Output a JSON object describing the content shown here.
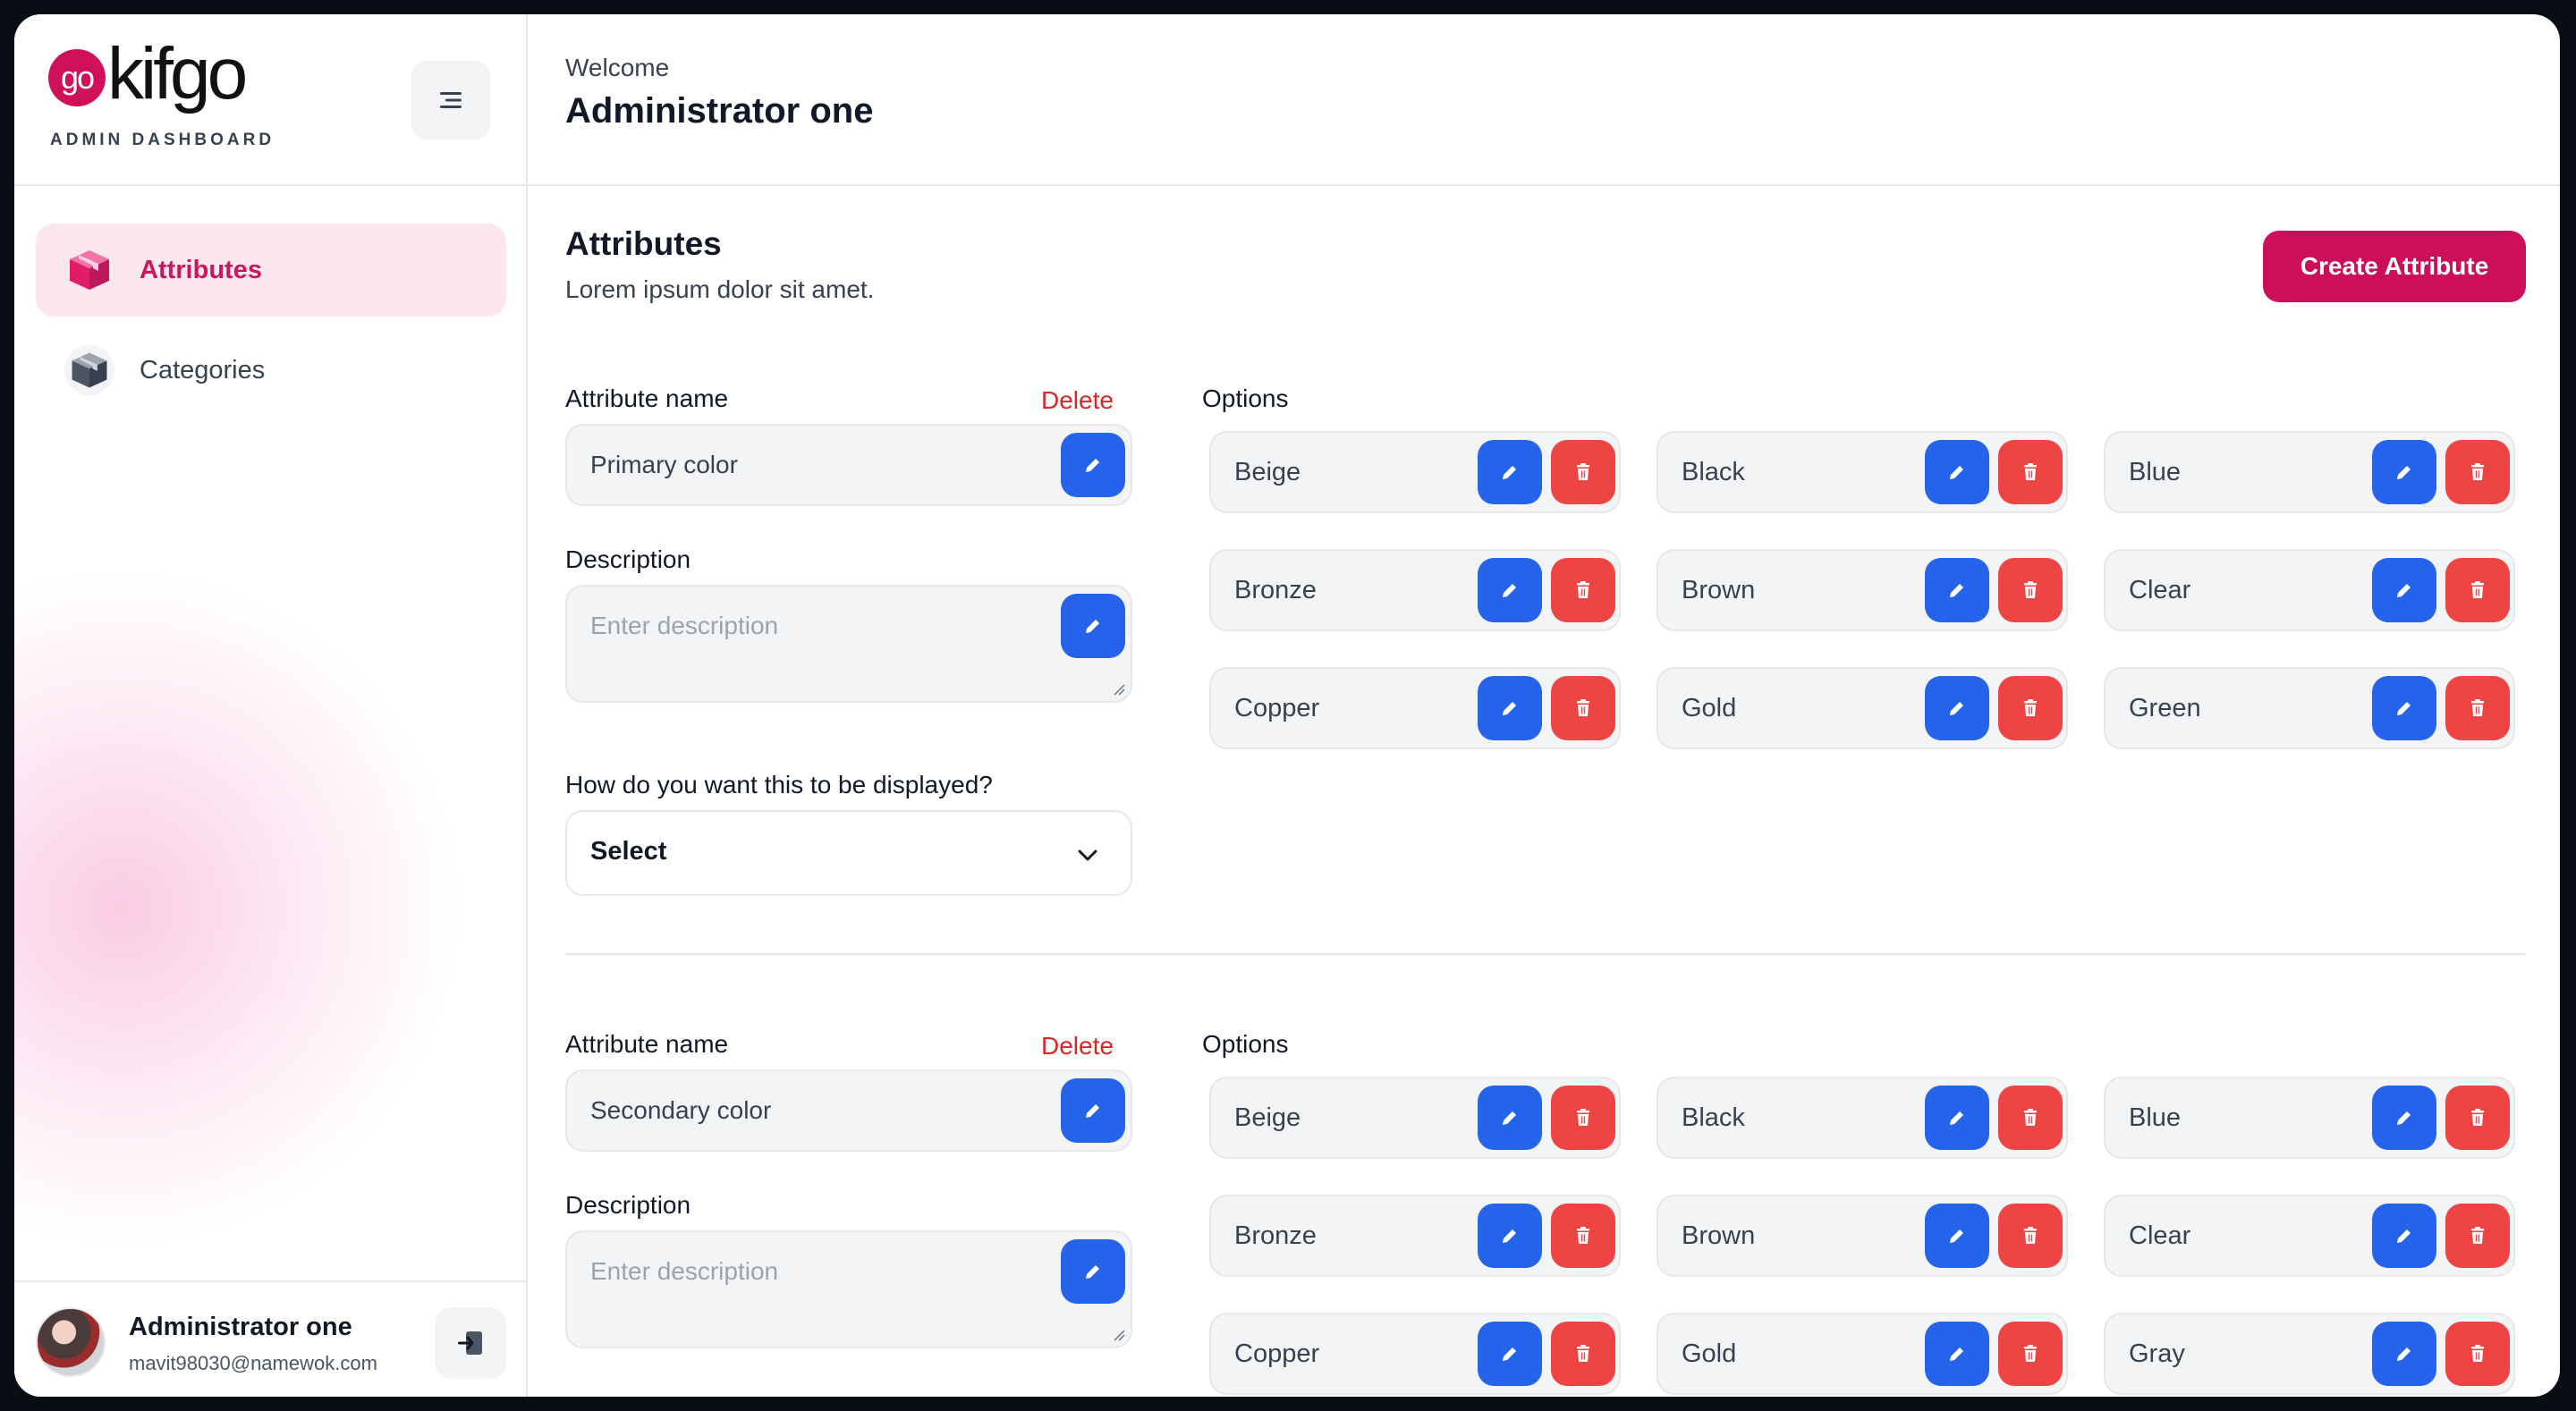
{
  "brand": {
    "logo_mark": "go",
    "logo_text": "kifgo",
    "subtitle": "ADMIN DASHBOARD"
  },
  "sidebar": {
    "items": [
      {
        "label": "Attributes",
        "icon": "box-icon",
        "active": true
      },
      {
        "label": "Categories",
        "icon": "box-icon",
        "active": false
      }
    ]
  },
  "user": {
    "name": "Administrator one",
    "email": "mavit98030@namewok.com"
  },
  "header": {
    "welcome": "Welcome",
    "title": "Administrator one"
  },
  "page": {
    "title": "Attributes",
    "subtitle": "Lorem ipsum dolor sit amet.",
    "create_label": "Create Attribute"
  },
  "labels": {
    "attribute_name": "Attribute name",
    "delete": "Delete",
    "description": "Description",
    "display_question": "How do you want this to be displayed?",
    "options": "Options"
  },
  "attributes": [
    {
      "name": "Primary color",
      "description_placeholder": "Enter description",
      "display_select": "Select",
      "options": [
        "Beige",
        "Black",
        "Blue",
        "Bronze",
        "Brown",
        "Clear",
        "Copper",
        "Gold",
        "Green"
      ]
    },
    {
      "name": "Secondary color",
      "description_placeholder": "Enter description",
      "options": [
        "Beige",
        "Black",
        "Blue",
        "Bronze",
        "Brown",
        "Clear",
        "Copper",
        "Gold",
        "Gray"
      ]
    }
  ],
  "colors": {
    "accent": "#cc0e5b",
    "edit": "#2563eb",
    "delete": "#ef4444",
    "active_bg": "#fce7ef"
  }
}
